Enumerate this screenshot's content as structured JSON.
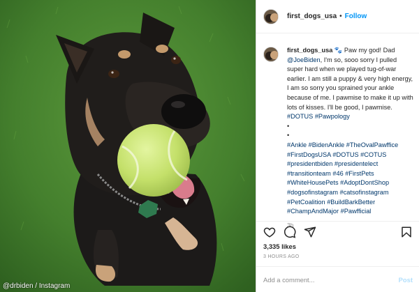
{
  "photo": {
    "credit": "@drbiden / Instagram"
  },
  "post": {
    "username": "first_dogs_usa",
    "separator": "•",
    "follow_label": "Follow",
    "caption_intro": "🐾 Paw my god! Dad ",
    "caption_mention": "@JoeBiden",
    "caption_main": ", I'm so, sooo sorry I pulled super hard when we played tug-of-war earlier. I am still a puppy & very high energy, I am so sorry you sprained your ankle because of me. I pawmise to make it up with lots of kisses. I'll be good, I pawmise. ",
    "caption_tags_1": "#DOTUS #Pawpology",
    "bullet": "•",
    "hashtags": "#Ankle #BidenAnkle #TheOvalPawffice #FirstDogsUSA #DOTUS #COTUS #presidentbiden #presidentelect #transitionteam #46 #FirstPets #WhiteHousePets #AdoptDontShop #dogsofinstagram #catsofinstagram #PetCoalition #BuildBarkBetter #ChampAndMajor #Pawfficial",
    "age": "3h",
    "likes": "3,335 likes",
    "posted": "3 HOURS AGO",
    "comment_placeholder": "Add a comment...",
    "post_label": "Post"
  },
  "icons": {
    "like": "heart-icon",
    "comment": "comment-icon",
    "share": "paper-plane-icon",
    "save": "bookmark-icon"
  },
  "colors": {
    "link": "#00376b",
    "follow": "#0095f6",
    "muted": "#8e8e8e",
    "post_disabled": "#b2dffc"
  }
}
